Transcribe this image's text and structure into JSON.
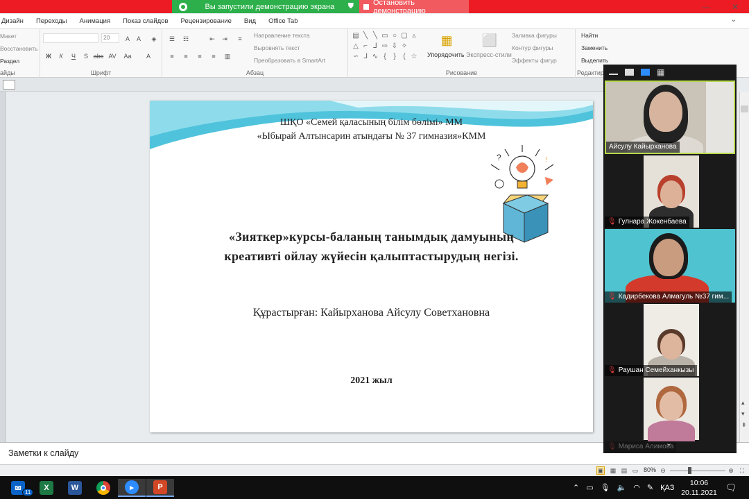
{
  "share_bar": {
    "status_text": "Вы запустили демонстрацию экрана",
    "stop_label": "Остановить демонстрацию",
    "status_color": "#2db04b",
    "bar_color": "#ed1c24"
  },
  "ribbon": {
    "tabs": [
      "Дизайн",
      "Переходы",
      "Анимация",
      "Показ слайдов",
      "Рецензирование",
      "Вид",
      "Office Tab"
    ],
    "slides_group": {
      "items": [
        "Макет",
        "Восстановить",
        "Раздел"
      ],
      "label": "айды"
    },
    "font_group": {
      "label": "Шрифт",
      "size": "20"
    },
    "paragraph_group": {
      "label": "Абзац",
      "items": [
        "Направление текста",
        "Выровнять текст",
        "Преобразовать в SmartArt"
      ]
    },
    "drawing_group": {
      "label": "Рисование",
      "arrange": "Упорядочить",
      "quick_styles": "Экспресс-стили",
      "fill": "Заливка фигуры",
      "outline": "Контур фигуры",
      "effects": "Эффекты фигур"
    },
    "editing_group": {
      "label": "Редактир",
      "find": "Найти",
      "replace": "Заменить",
      "select": "Выделить"
    }
  },
  "slide": {
    "header_line1": "ШҚО «Семей қаласының білім бөлімі» ММ",
    "header_line2": "«Ыбырай Алтынсарин атындағы № 37 гимназия»КММ",
    "title_line1": "«Зияткер»курсы-баланың  танымдық дамуының",
    "title_line2": "креативті  ойлау жүйесін   қалыптастырудың  негізі.",
    "author": "Құрастырған: Кайырханова Айсулу Советхановна",
    "year": "2021 жыл"
  },
  "notes": {
    "placeholder": "Заметки к слайду"
  },
  "status": {
    "zoom": "80%"
  },
  "zoom_panel": {
    "participants": [
      {
        "name": "Айсулу Кайырханова",
        "muted": false
      },
      {
        "name": "Гулнара Жокенбаева",
        "muted": true
      },
      {
        "name": "Кадирбекова Алмагуль №37 гим...",
        "muted": true
      },
      {
        "name": "Раушан Семейханкызы",
        "muted": true
      },
      {
        "name": "Мариса Алимова",
        "muted": true
      }
    ]
  },
  "taskbar": {
    "mail_badge": "11",
    "language": "ҚАЗ",
    "time": "10:06",
    "date": "20.11.2021"
  }
}
